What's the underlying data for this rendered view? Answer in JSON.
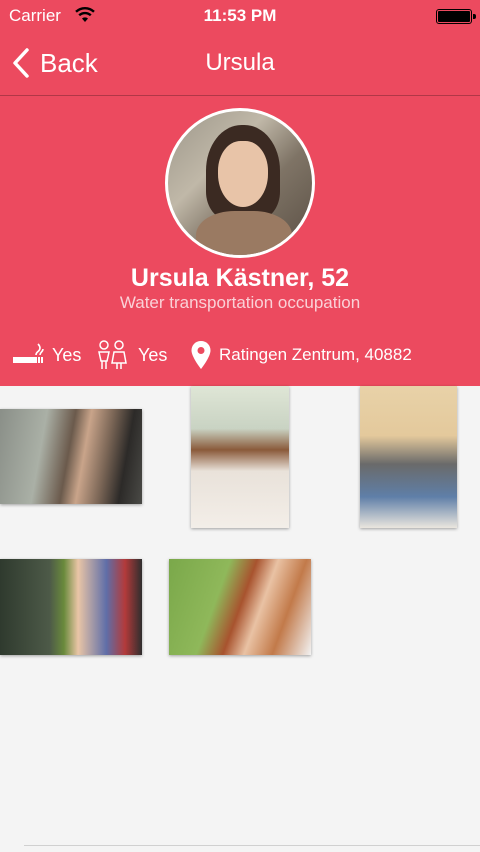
{
  "status_bar": {
    "carrier": "Carrier",
    "time": "11:53 PM"
  },
  "nav": {
    "back_label": "Back",
    "title": "Ursula"
  },
  "profile": {
    "name": "Ursula Kästner, 52",
    "occupation": "Water transportation occupation",
    "smoking": "Yes",
    "children": "Yes",
    "location": "Ratingen Zentrum, 40882"
  },
  "colors": {
    "header_bg": "#ec4a5f",
    "page_bg": "#f4f4f4"
  },
  "icons": [
    "back-chevron-icon",
    "wifi-icon",
    "battery-icon",
    "cigarette-icon",
    "children-icon",
    "location-pin-icon"
  ],
  "photos": [
    {
      "label": "photo-1"
    },
    {
      "label": "photo-2"
    },
    {
      "label": "photo-3"
    },
    {
      "label": "photo-4"
    },
    {
      "label": "photo-5"
    }
  ]
}
